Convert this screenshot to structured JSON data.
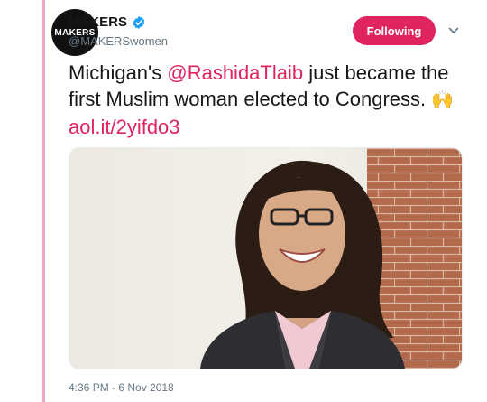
{
  "tweet": {
    "display_name": "MAKERS",
    "handle": "@MAKERSwomen",
    "avatar_text": "MAKERS",
    "follow_label": "Following",
    "text_part1": "Michigan's ",
    "mention": "@RashidaTlaib",
    "text_part2": " just became the first Muslim woman elected to Congress. ",
    "emoji": "🙌",
    "link": "aol.it/2yifdo3",
    "timestamp": "4:36 PM - 6 Nov 2018"
  },
  "colors": {
    "accent": "#e0245e",
    "thread_line": "#f5a3c7",
    "verified": "#1da1f2",
    "text": "#14171a",
    "muted": "#657786"
  },
  "icons": {
    "verified": "verified-badge-icon",
    "menu": "chevron-down-icon"
  }
}
